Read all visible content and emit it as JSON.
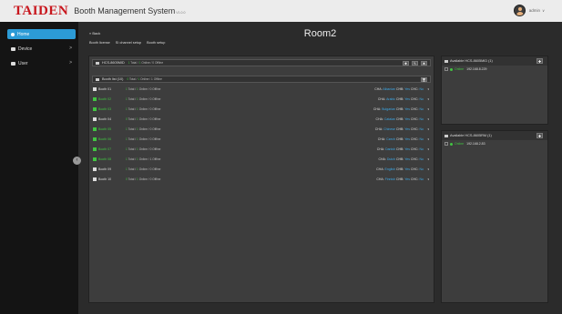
{
  "header": {
    "brand": "TAIDEN",
    "title": "Booth Management System",
    "version": "V1.0.0",
    "user": "admin",
    "caret": "∨"
  },
  "sidebar": {
    "items": [
      {
        "label": "Home",
        "chevron": ""
      },
      {
        "label": "Device",
        "chevron": ">"
      },
      {
        "label": "User",
        "chevron": ">"
      }
    ],
    "collapse": "‹"
  },
  "main": {
    "back": "« Back",
    "room": "Room2",
    "tabs": [
      "Booth license",
      "SI channel setup",
      "Booth setup"
    ],
    "device_bar": {
      "name": "HCS-8605MID",
      "total": "1",
      "online": "1",
      "offline": "0",
      "total_label": "Total",
      "online_label": "Online",
      "offline_label": "Offline",
      "buttons": [
        "✚",
        "✎",
        "✖"
      ]
    },
    "booth_bar": {
      "name": "Booth list (10)",
      "total": "0",
      "online": "1",
      "offline": "1",
      "total_label": "Total",
      "online_label": "Online",
      "offline_label": "Offline",
      "button": "🗑"
    },
    "booths": [
      {
        "name": "Booth 01",
        "total": "1",
        "online": "1",
        "offline": "0",
        "cha": "Albanian",
        "chb": "Yes",
        "chc": "No",
        "online_state": false
      },
      {
        "name": "Booth 02",
        "total": "1",
        "online": "1",
        "offline": "0",
        "cha": "Arabic",
        "chb": "Yes",
        "chc": "No",
        "online_state": true
      },
      {
        "name": "Booth 03",
        "total": "1",
        "online": "1",
        "offline": "0",
        "cha": "Bulgarian",
        "chb": "Yes",
        "chc": "No",
        "online_state": true
      },
      {
        "name": "Booth 04",
        "total": "0",
        "online": "1",
        "offline": "0",
        "cha": "Catalan",
        "chb": "Yes",
        "chc": "No",
        "online_state": false
      },
      {
        "name": "Booth 05",
        "total": "1",
        "online": "1",
        "offline": "0",
        "cha": "Chinese",
        "chb": "Yes",
        "chc": "No",
        "online_state": true
      },
      {
        "name": "Booth 06",
        "total": "1",
        "online": "1",
        "offline": "0",
        "cha": "Czech",
        "chb": "Yes",
        "chc": "No",
        "online_state": true
      },
      {
        "name": "Booth 07",
        "total": "1",
        "online": "1",
        "offline": "0",
        "cha": "Danish",
        "chb": "Yes",
        "chc": "No",
        "online_state": true
      },
      {
        "name": "Booth 08",
        "total": "1",
        "online": "1",
        "offline": "1",
        "cha": "Dutch",
        "chb": "Yes",
        "chc": "No",
        "online_state": true
      },
      {
        "name": "Booth 09",
        "total": "1",
        "online": "1",
        "offline": "0",
        "cha": "English",
        "chb": "Yes",
        "chc": "No",
        "online_state": false
      },
      {
        "name": "Booth 10",
        "total": "0",
        "online": "1",
        "offline": "0",
        "cha": "Finnish",
        "chb": "Yes",
        "chc": "No",
        "online_state": false
      }
    ],
    "ch_labels": {
      "a": "CHA:",
      "b": "CHB:",
      "c": "CHC:",
      "arrow": "▾"
    }
  },
  "available": [
    {
      "title": "Available HCS-8605MID (1)",
      "add": "✚",
      "devices": [
        {
          "status": "Online",
          "ip": "192.168.8.229"
        }
      ]
    },
    {
      "title": "Available HCS-8605RM (1)",
      "add": "✚",
      "devices": [
        {
          "status": "Online",
          "ip": "192.168.2.83"
        }
      ]
    }
  ],
  "colors": {
    "accent": "#2c9bd6",
    "online": "#42c442",
    "brand": "#c8161d"
  }
}
